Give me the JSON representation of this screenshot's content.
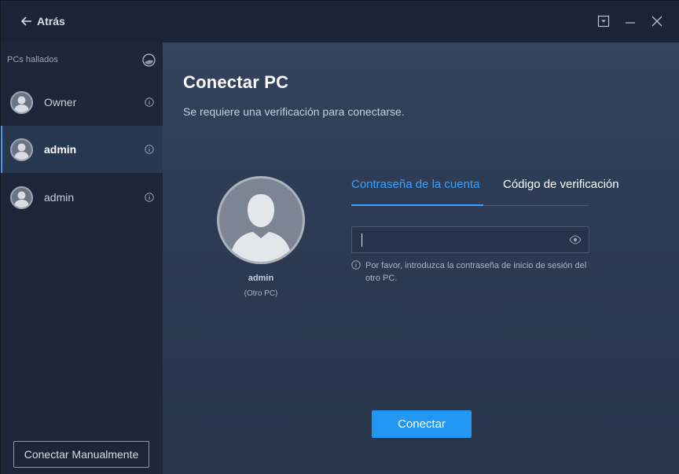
{
  "titlebar": {
    "back_label": "Atrás"
  },
  "sidebar": {
    "header": "PCs hallados",
    "items": [
      {
        "label": "Owner",
        "active": false
      },
      {
        "label": "admin",
        "active": true
      },
      {
        "label": "admin",
        "active": false
      }
    ],
    "manual_button": "Conectar Manualmente"
  },
  "main": {
    "title": "Conectar PC",
    "subtitle": "Se requiere una verificación para conectarse.",
    "target": {
      "name": "admin",
      "sub": "(Otro PC)"
    },
    "tabs": [
      {
        "label": "Contraseña de la cuenta",
        "active": true
      },
      {
        "label": "Código de verificación",
        "active": false
      }
    ],
    "password": {
      "value": ""
    },
    "hint": "Por favor, introduzca la contraseña de inicio de sesión del otro PC.",
    "connect_button": "Conectar"
  },
  "colors": {
    "accent": "#3aa0ff",
    "button": "#2196f3",
    "sidebar_bg": "#1c2638",
    "main_bg": "#2f3e57"
  },
  "icons": [
    "back-arrow-icon",
    "dropdown-icon",
    "minimize-icon",
    "close-icon",
    "refresh-icon",
    "user-avatar-icon",
    "info-icon",
    "eye-icon"
  ]
}
